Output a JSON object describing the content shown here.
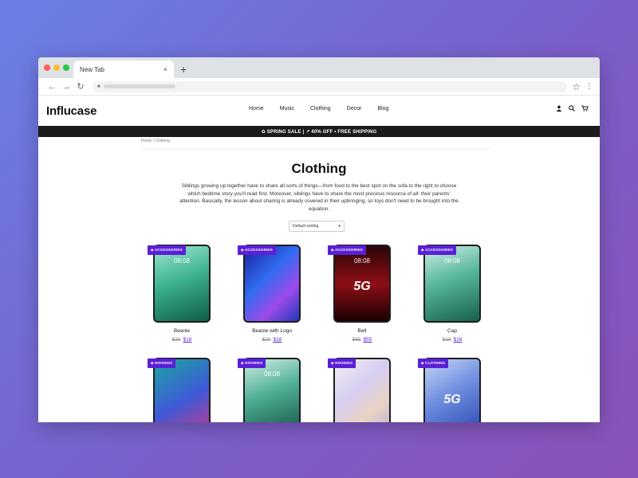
{
  "browser": {
    "tab_title": "New Tab",
    "tab_close": "×",
    "new_tab": "+",
    "back": "←",
    "forward": "→",
    "reload": "↻",
    "bookmark": "☆",
    "menu": "⋮"
  },
  "site": {
    "logo": "Influcase",
    "nav": [
      "Home",
      "Music",
      "Clothing",
      "Decor",
      "Blog"
    ],
    "icons": [
      "user-icon",
      "search-icon",
      "cart-icon"
    ],
    "promo": "✿ SPRING SALE | ↗ 40% OFF • FREE SHIPPING"
  },
  "breadcrumb": "Home / Clothing",
  "page": {
    "title": "Clothing",
    "description": "Siblings growing up together have to share all sorts of things—from food to the best spot on the sofa to the right to choose which bedtime story you'll read first. Moreover, siblings have to share the most precious resource of all: their parents' attention. Basically, the lesson about sharing is already covered in their upbringing, so toys don't need to be brought into the equation.",
    "sort_label": "Default sorting",
    "sort_caret": "▾"
  },
  "products": [
    {
      "badge": "ACCESSORIES",
      "name": "Beanie",
      "old_price": "$20",
      "price": "$18",
      "screen_time": "08:08",
      "big": ""
    },
    {
      "badge": "ACCESSORIES",
      "name": "Beanie with Logo",
      "old_price": "$20",
      "price": "$18",
      "screen_time": "",
      "big": ""
    },
    {
      "badge": "ACCESSORIES",
      "name": "Belt",
      "old_price": "$65",
      "price": "$55",
      "screen_time": "08:08",
      "big": "5G"
    },
    {
      "badge": "ACCESSORIES",
      "name": "Cap",
      "old_price": "$18",
      "price": "$16",
      "screen_time": "08:08",
      "big": ""
    },
    {
      "badge": "HOODIES",
      "name": "",
      "old_price": "",
      "price": "",
      "screen_time": "",
      "big": ""
    },
    {
      "badge": "HOODIES",
      "name": "",
      "old_price": "",
      "price": "",
      "screen_time": "08:08",
      "big": ""
    },
    {
      "badge": "HOODIES",
      "name": "",
      "old_price": "",
      "price": "",
      "screen_time": "",
      "big": ""
    },
    {
      "badge": "CLOTHING",
      "name": "",
      "old_price": "",
      "price": "",
      "screen_time": "",
      "big": "5G"
    }
  ],
  "colors": {
    "accent": "#5a1fd6",
    "promo_bg": "#1b1b1b",
    "dot_red": "#ff5f57",
    "dot_yellow": "#febc2e",
    "dot_green": "#28c840"
  }
}
